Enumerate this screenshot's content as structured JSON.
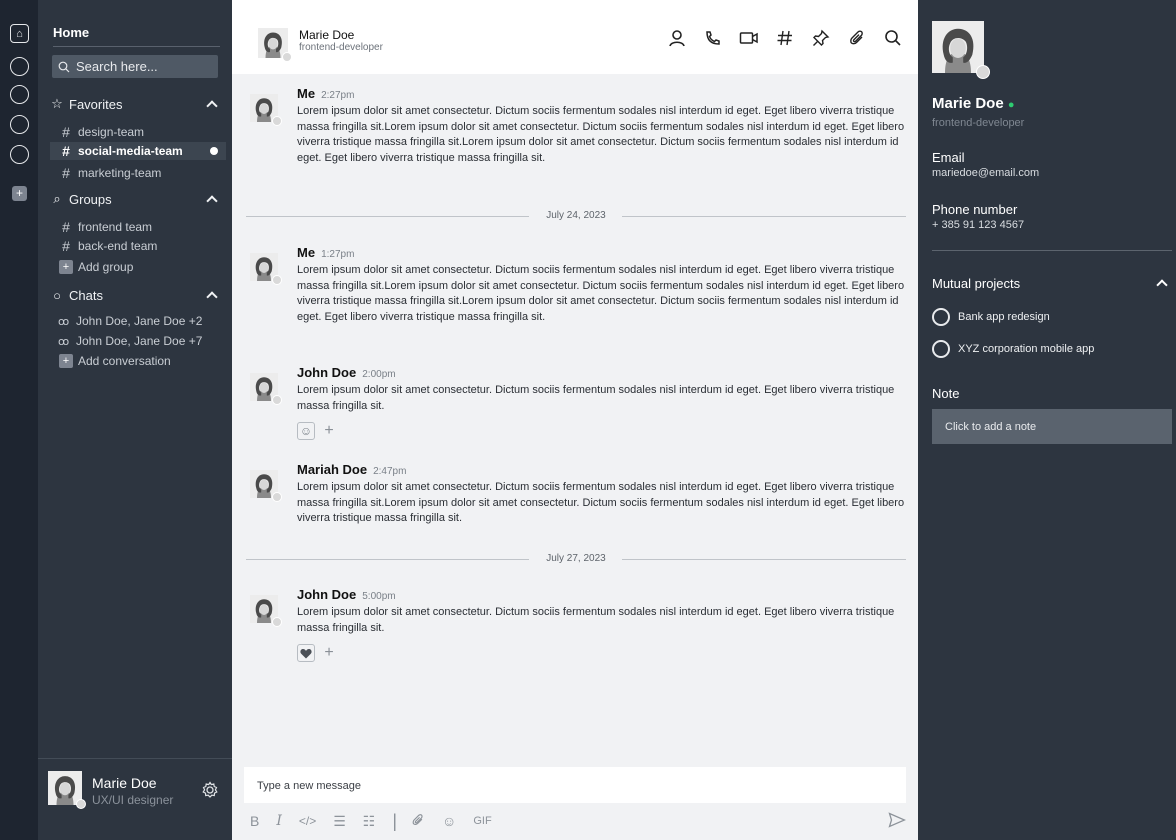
{
  "colors": {
    "rail": "#1e2530",
    "sidebar": "#2d3540",
    "online": "#2ecc71"
  },
  "sidebar": {
    "home_title": "Home",
    "search_placeholder": "Search here...",
    "favorites": {
      "label": "Favorites",
      "items": [
        "design-team",
        "social-media-team",
        "marketing-team"
      ],
      "active": "social-media-team"
    },
    "groups": {
      "label": "Groups",
      "items": [
        "frontend team",
        "back-end team"
      ],
      "add": "Add group"
    },
    "chats": {
      "label": "Chats",
      "items": [
        "John Doe, Jane Doe +2",
        "John Doe, Jane Doe +7"
      ],
      "add": "Add conversation"
    },
    "user": {
      "name": "Marie Doe",
      "role": "UX/UI designer"
    }
  },
  "header": {
    "name": "Marie Doe",
    "role": "frontend-developer"
  },
  "messages": [
    {
      "author": "Me",
      "time": "2:27pm",
      "text": "Lorem ipsum dolor sit amet consectetur. Dictum sociis fermentum sodales nisl interdum id eget. Eget libero viverra tristique massa fringilla sit.Lorem ipsum dolor sit amet consectetur. Dictum sociis fermentum sodales nisl interdum id eget. Eget libero viverra tristique massa fringilla sit.Lorem ipsum dolor sit amet consectetur. Dictum sociis fermentum sodales nisl interdum id eget. Eget libero viverra tristique massa fringilla sit."
    },
    {
      "author": "Me",
      "time": "1:27pm",
      "text": "Lorem ipsum dolor sit amet consectetur. Dictum sociis fermentum sodales nisl interdum id eget. Eget libero viverra tristique massa fringilla sit.Lorem ipsum dolor sit amet consectetur. Dictum sociis fermentum sodales nisl interdum id eget. Eget libero viverra tristique massa fringilla sit.Lorem ipsum dolor sit amet consectetur. Dictum sociis fermentum sodales nisl interdum id eget. Eget libero viverra tristique massa fringilla sit."
    },
    {
      "author": "John Doe",
      "time": "2:00pm",
      "text": "Lorem ipsum dolor sit amet consectetur. Dictum sociis fermentum sodales nisl interdum id eget. Eget libero viverra tristique massa fringilla sit."
    },
    {
      "author": "Mariah Doe",
      "time": "2:47pm",
      "text": "Lorem ipsum dolor sit amet consectetur. Dictum sociis fermentum sodales nisl interdum id eget. Eget libero viverra tristique massa fringilla sit.Lorem ipsum dolor sit amet consectetur. Dictum sociis fermentum sodales nisl interdum id eget. Eget libero viverra tristique massa fringilla sit."
    },
    {
      "author": "John Doe",
      "time": "5:00pm",
      "text": "Lorem ipsum dolor sit amet consectetur. Dictum sociis fermentum sodales nisl interdum id eget. Eget libero viverra tristique massa fringilla sit."
    }
  ],
  "dates": [
    "July 24, 2023",
    "July 27, 2023"
  ],
  "composer": {
    "placeholder": "Type a new message",
    "gif": "GIF"
  },
  "details": {
    "name": "Marie Doe",
    "role": "frontend-developer",
    "email_label": "Email",
    "email": "mariedoe@email.com",
    "phone_label": "Phone number",
    "phone": "+ 385 91 123 4567",
    "projects_label": "Mutual projects",
    "projects": [
      "Bank app redesign",
      "XYZ corporation mobile app"
    ],
    "note_label": "Note",
    "note_placeholder": "Click to add a note"
  }
}
